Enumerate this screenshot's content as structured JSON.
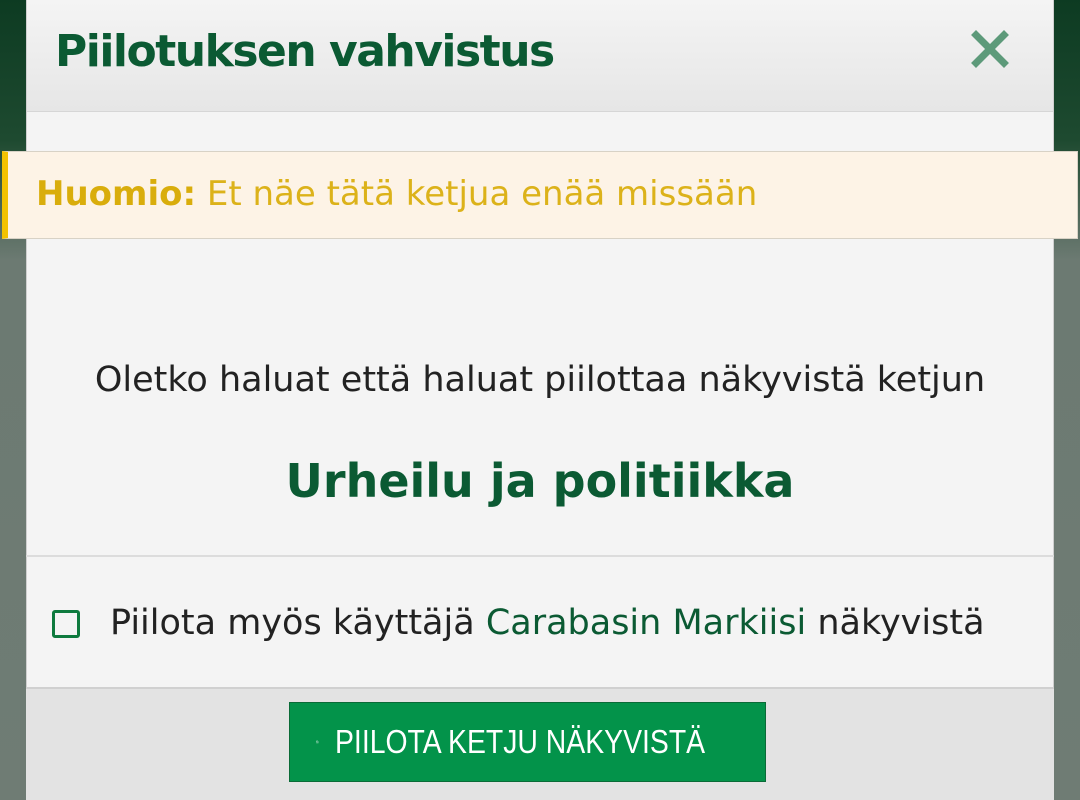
{
  "dialog": {
    "title": "Piilotuksen vahvistus",
    "close_icon": "close-icon"
  },
  "alert": {
    "strong": "Huomio:",
    "text": " Et näe tätä ketjua enää missään"
  },
  "content": {
    "question": "Oletko haluat että haluat piilottaa näkyvistä ketjun",
    "thread_title": "Urheilu ja politiikka"
  },
  "option": {
    "checked": false,
    "label_prefix": "Piilota myös käyttäjä ",
    "user_name": "Carabasin Markiisi",
    "label_suffix": " näkyvistä"
  },
  "footer": {
    "submit_label": "PIILOTA KETJU NÄKYVISTÄ",
    "submit_icon": "save-icon"
  },
  "colors": {
    "brand_green": "#0b5a33",
    "button_green": "#03934a",
    "warning_yellow": "#f2c200",
    "warning_bg": "#fdf3e6"
  }
}
